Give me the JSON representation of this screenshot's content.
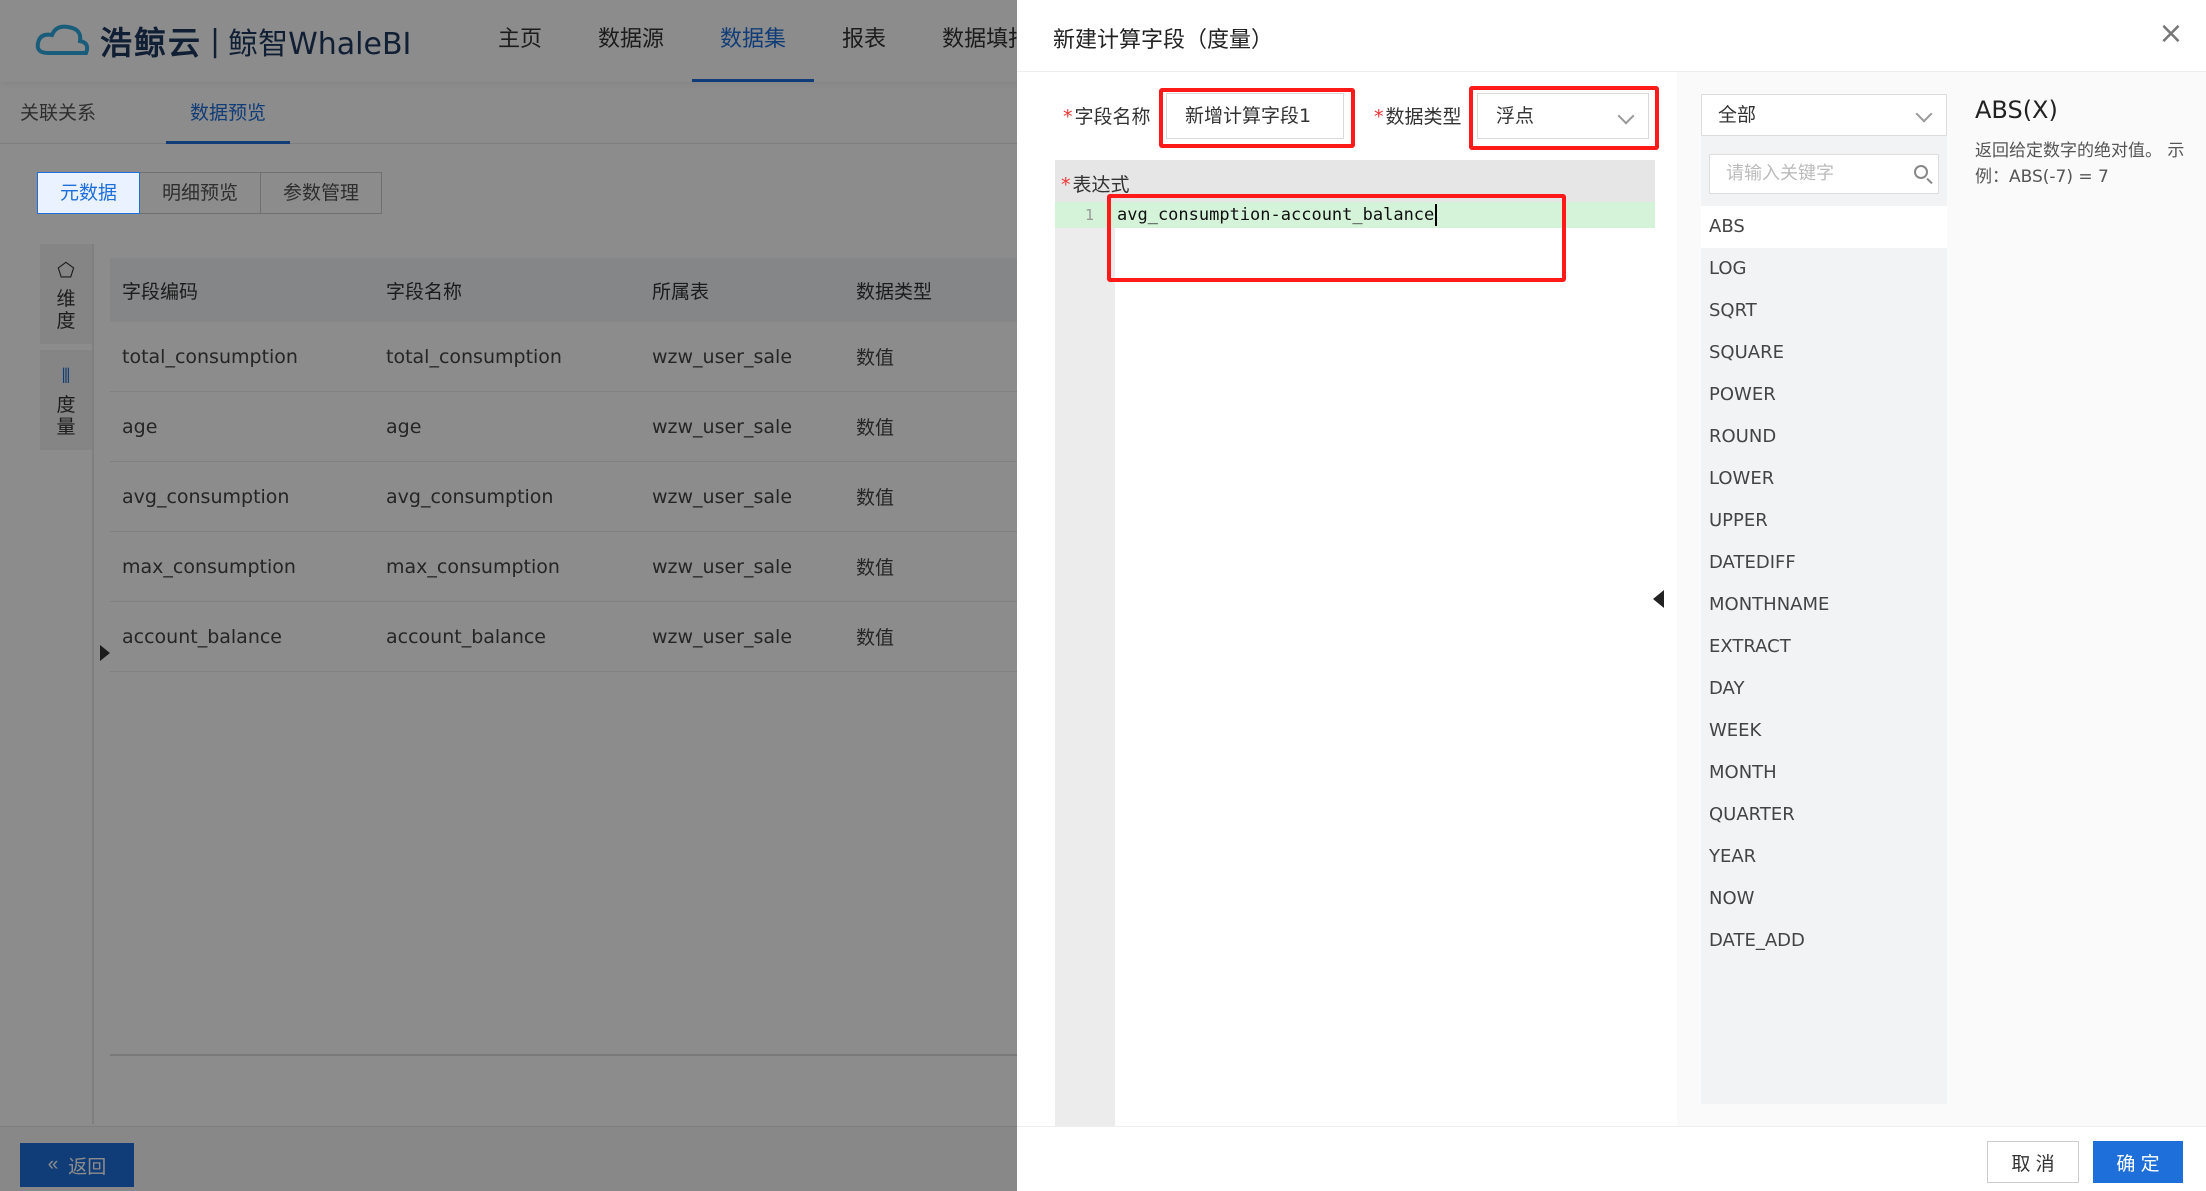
{
  "app": {
    "logo_brand": "浩鲸云",
    "logo_product": "鲸智WhaleBI",
    "nav": [
      "主页",
      "数据源",
      "数据集",
      "报表",
      "数据填报"
    ],
    "nav_active": "数据集",
    "subtabs": [
      "关联关系",
      "数据预览"
    ],
    "segments": [
      "元数据",
      "明细预览",
      "参数管理"
    ],
    "side_tabs": [
      {
        "label": "维度",
        "icon": "dimension-icon"
      },
      {
        "label": "度量",
        "icon": "measure-icon"
      }
    ],
    "table": {
      "headers": [
        "字段编码",
        "字段名称",
        "所属表",
        "数据类型"
      ],
      "rows": [
        [
          "total_consumption",
          "total_consumption",
          "wzw_user_sale",
          "数值"
        ],
        [
          "age",
          "age",
          "wzw_user_sale",
          "数值"
        ],
        [
          "avg_consumption",
          "avg_consumption",
          "wzw_user_sale",
          "数值"
        ],
        [
          "max_consumption",
          "max_consumption",
          "wzw_user_sale",
          "数值"
        ],
        [
          "account_balance",
          "account_balance",
          "wzw_user_sale",
          "数值"
        ]
      ]
    },
    "back_label": "返回",
    "accent": "#1e6fd9"
  },
  "drawer": {
    "title": "新建计算字段（度量）",
    "field_name_label": "字段名称",
    "field_name_value": "新增计算字段1",
    "data_type_label": "数据类型",
    "data_type_value": "浮点",
    "expression_label": "表达式",
    "line_number": "1",
    "expression": "avg_consumption-account_balance",
    "func_category": "全部",
    "search_placeholder": "请输入关键字",
    "functions": [
      "ABS",
      "LOG",
      "SQRT",
      "SQUARE",
      "POWER",
      "ROUND",
      "LOWER",
      "UPPER",
      "DATEDIFF",
      "MONTHNAME",
      "EXTRACT",
      "DAY",
      "WEEK",
      "MONTH",
      "QUARTER",
      "YEAR",
      "NOW",
      "DATE_ADD"
    ],
    "selected_function_signature": "ABS(X)",
    "selected_function_desc": "返回给定数字的绝对值。 示例：ABS(-7) = 7",
    "cancel_label": "取 消",
    "ok_label": "确 定",
    "highlight_color": "#ff1a1a"
  }
}
